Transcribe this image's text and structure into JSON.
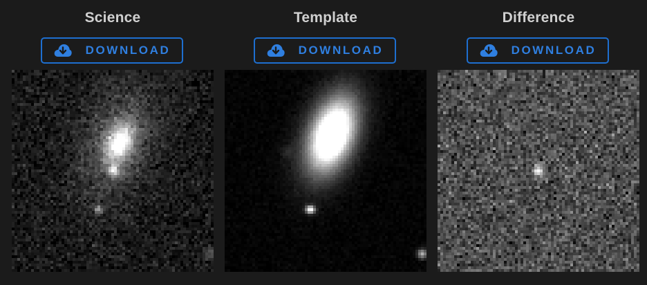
{
  "panels": [
    {
      "title": "Science",
      "download_label": "DOWNLOAD"
    },
    {
      "title": "Template",
      "download_label": "DOWNLOAD"
    },
    {
      "title": "Difference",
      "download_label": "DOWNLOAD"
    }
  ],
  "icons": {
    "download": "cloud-download-icon"
  },
  "colors": {
    "background": "#1b1b1b",
    "title": "#d0d0d0",
    "accent": "#1e6fd0"
  }
}
